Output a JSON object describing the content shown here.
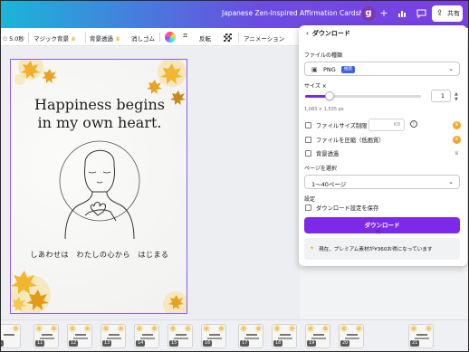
{
  "app": {
    "doc_title": "Japanese Zen-Inspired Affirmation Cards№02",
    "avatar_letter": "g",
    "share_label": "共有"
  },
  "toolbar": {
    "duration": "5.0秒",
    "magic_bg": "マジック背景",
    "bg_remove": "背景透過",
    "eraser": "消しゴム",
    "flip": "反転",
    "animation": "アニメーション"
  },
  "page": {
    "headline_line1": "Happiness begins",
    "headline_line2": "in my own heart.",
    "japanese_line": "しあわせは　わたしの心から　はじまる"
  },
  "download_panel": {
    "title": "ダウンロード",
    "file_type_label": "ファイルの種類",
    "file_type_value": "PNG",
    "file_type_badge": "推奨",
    "size_label": "サイズ ×",
    "size_value": "1",
    "size_fraction": 0.2,
    "dimensions": "1,083 × 1,535 px",
    "limit_filesize_label": "ファイルサイズ制限",
    "kb_placeholder": "KB",
    "compress_label": "ファイルを圧縮（低画質）",
    "transparent_label": "背景透過",
    "pages_label": "ページを選択",
    "pages_value": "1〜40ページ",
    "settings_label": "設定",
    "save_settings_label": "ダウンロード設定を保存",
    "download_button": "ダウンロード",
    "promo_text": "現在、プレミアム素材が¥360お得になっています"
  },
  "thumbnails": [
    "1",
    "11",
    "12",
    "13",
    "14",
    "15",
    "16",
    "17",
    "18",
    "19",
    "20",
    "21"
  ],
  "colors": {
    "accent": "#7d2ae8",
    "page_border": "#8b5cf6",
    "premium": "#f5a524",
    "badge": "#3d63e0"
  }
}
